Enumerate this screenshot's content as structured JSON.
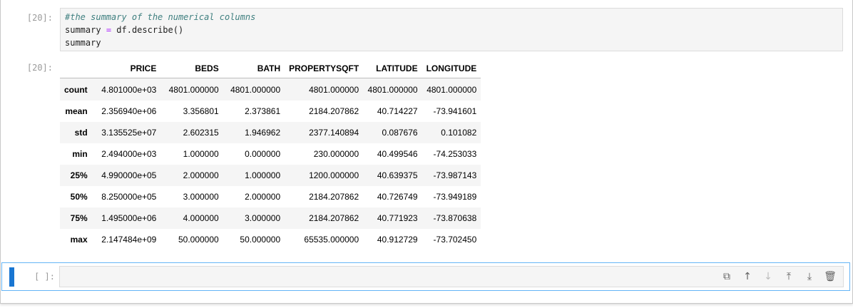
{
  "cell1": {
    "prompt": "[20]:",
    "code": {
      "comment": "#the summary of the numerical columns",
      "line2_var": "summary",
      "line2_op": "=",
      "line2_expr": "df.describe()",
      "line3": "summary"
    }
  },
  "output1": {
    "prompt": "[20]:",
    "columns": [
      "PRICE",
      "BEDS",
      "BATH",
      "PROPERTYSQFT",
      "LATITUDE",
      "LONGITUDE"
    ],
    "rows": [
      {
        "index": "count",
        "values": [
          "4.801000e+03",
          "4801.000000",
          "4801.000000",
          "4801.000000",
          "4801.000000",
          "4801.000000"
        ]
      },
      {
        "index": "mean",
        "values": [
          "2.356940e+06",
          "3.356801",
          "2.373861",
          "2184.207862",
          "40.714227",
          "-73.941601"
        ]
      },
      {
        "index": "std",
        "values": [
          "3.135525e+07",
          "2.602315",
          "1.946962",
          "2377.140894",
          "0.087676",
          "0.101082"
        ]
      },
      {
        "index": "min",
        "values": [
          "2.494000e+03",
          "1.000000",
          "0.000000",
          "230.000000",
          "40.499546",
          "-74.253033"
        ]
      },
      {
        "index": "25%",
        "values": [
          "4.990000e+05",
          "2.000000",
          "1.000000",
          "1200.000000",
          "40.639375",
          "-73.987143"
        ]
      },
      {
        "index": "50%",
        "values": [
          "8.250000e+05",
          "3.000000",
          "2.000000",
          "2184.207862",
          "40.726749",
          "-73.949189"
        ]
      },
      {
        "index": "75%",
        "values": [
          "1.495000e+06",
          "4.000000",
          "3.000000",
          "2184.207862",
          "40.771923",
          "-73.870638"
        ]
      },
      {
        "index": "max",
        "values": [
          "2.147484e+09",
          "50.000000",
          "50.000000",
          "65535.000000",
          "40.912729",
          "-73.702450"
        ]
      }
    ]
  },
  "cell2": {
    "prompt": "[ ]:",
    "toolbar": [
      {
        "name": "duplicate-icon",
        "glyph": "⧉"
      },
      {
        "name": "move-up-icon",
        "glyph": "↑"
      },
      {
        "name": "move-down-icon",
        "glyph": "↓"
      },
      {
        "name": "insert-above-icon",
        "glyph": "⤒"
      },
      {
        "name": "insert-below-icon",
        "glyph": "⤓"
      },
      {
        "name": "delete-icon",
        "glyph": "🗑"
      }
    ]
  },
  "colors": {
    "active_bar": "#1976d2",
    "active_border": "#64b5f6",
    "comment": "#408080",
    "operator": "#aa22ff"
  }
}
